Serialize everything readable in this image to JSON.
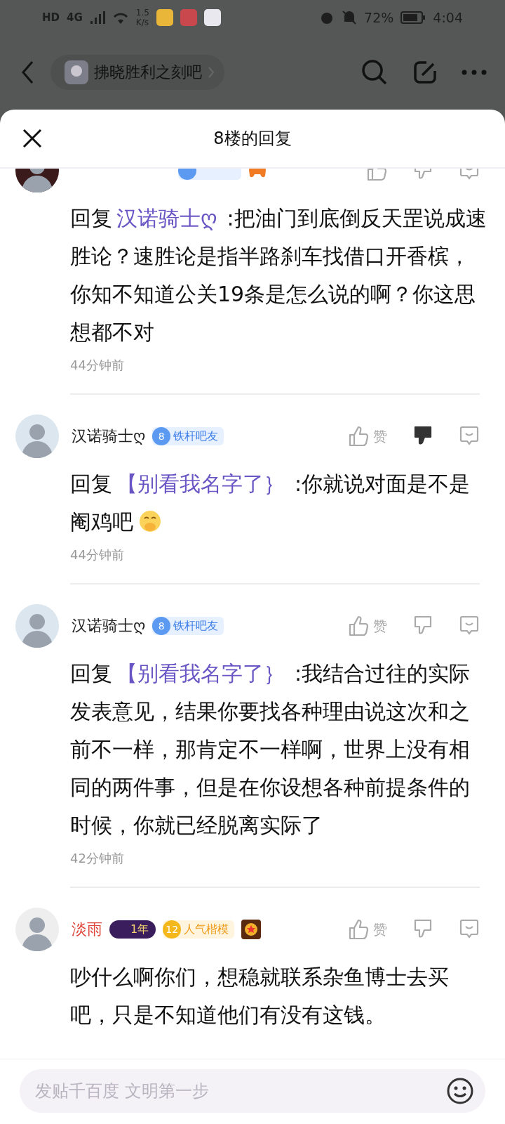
{
  "status_bar": {
    "hd": "HD",
    "network": "4G",
    "speed_value": "1.5",
    "speed_unit": "K/s",
    "battery": "72%",
    "time": "4:04"
  },
  "nav": {
    "forum": "拂晓胜利之刻吧"
  },
  "sheet": {
    "title": "8楼的回复"
  },
  "comments": [
    {
      "badges": [
        {
          "kind": "level"
        },
        {
          "kind": "emblem"
        }
      ],
      "disliked": false,
      "reply_prefix": "回复",
      "reply_to": "汉诺骑士ღ",
      "text": ":把油门到底倒反天罡说成速胜论？速胜论是指半路刹车找借口开香槟，你知不知道公关19条是怎么说的啊？你这思想都不对",
      "emoji": false,
      "time": "44分钟前"
    },
    {
      "name": "汉诺骑士ღ",
      "vip": false,
      "badges": [
        {
          "kind": "level",
          "number": "8",
          "label": "铁杆吧友"
        }
      ],
      "like": "赞",
      "disliked": true,
      "reply_prefix": "回复",
      "reply_to": "【别看我名字了｝",
      "text": ":你就说对面是不是阉鸡吧",
      "emoji": true,
      "time": "44分钟前"
    },
    {
      "name": "汉诺骑士ღ",
      "vip": false,
      "badges": [
        {
          "kind": "level",
          "number": "8",
          "label": "铁杆吧友"
        }
      ],
      "like": "赞",
      "disliked": false,
      "reply_prefix": "回复",
      "reply_to": "【别看我名字了｝",
      "text": ":我结合过往的实际发表意见，结果你要找各种理由说这次和之前不一样，那肯定不一样啊，世界上没有相同的两件事，但是在你设想各种前提条件的时候，你就已经脱离实际了",
      "emoji": false,
      "time": "42分钟前"
    },
    {
      "name": "淡雨",
      "vip": true,
      "badges": [
        {
          "kind": "year",
          "label": "1年"
        },
        {
          "kind": "gold",
          "number": "12",
          "label": "人气楷模"
        },
        {
          "kind": "medal"
        }
      ],
      "like": "赞",
      "disliked": false,
      "text": "吵什么啊你们，想稳就联系杂鱼博士去买吧，只是不知道他们有没有这钱。",
      "emoji": false
    }
  ],
  "composer": {
    "placeholder": "发贴千百度 文明第一步"
  }
}
